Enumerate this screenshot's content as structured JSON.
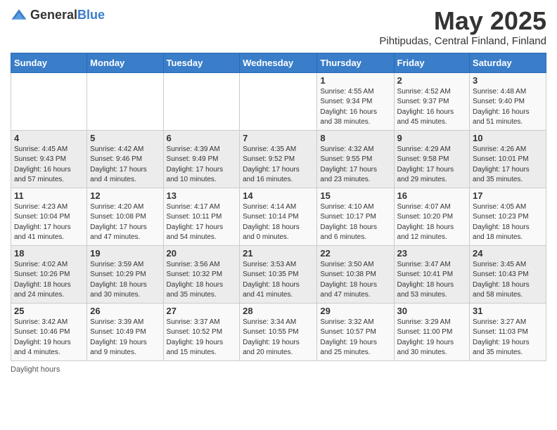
{
  "header": {
    "logo_general": "General",
    "logo_blue": "Blue",
    "month_title": "May 2025",
    "location": "Pihtipudas, Central Finland, Finland"
  },
  "days_of_week": [
    "Sunday",
    "Monday",
    "Tuesday",
    "Wednesday",
    "Thursday",
    "Friday",
    "Saturday"
  ],
  "weeks": [
    [
      {
        "day": "",
        "info": ""
      },
      {
        "day": "",
        "info": ""
      },
      {
        "day": "",
        "info": ""
      },
      {
        "day": "",
        "info": ""
      },
      {
        "day": "1",
        "info": "Sunrise: 4:55 AM\nSunset: 9:34 PM\nDaylight: 16 hours\nand 38 minutes."
      },
      {
        "day": "2",
        "info": "Sunrise: 4:52 AM\nSunset: 9:37 PM\nDaylight: 16 hours\nand 45 minutes."
      },
      {
        "day": "3",
        "info": "Sunrise: 4:48 AM\nSunset: 9:40 PM\nDaylight: 16 hours\nand 51 minutes."
      }
    ],
    [
      {
        "day": "4",
        "info": "Sunrise: 4:45 AM\nSunset: 9:43 PM\nDaylight: 16 hours\nand 57 minutes."
      },
      {
        "day": "5",
        "info": "Sunrise: 4:42 AM\nSunset: 9:46 PM\nDaylight: 17 hours\nand 4 minutes."
      },
      {
        "day": "6",
        "info": "Sunrise: 4:39 AM\nSunset: 9:49 PM\nDaylight: 17 hours\nand 10 minutes."
      },
      {
        "day": "7",
        "info": "Sunrise: 4:35 AM\nSunset: 9:52 PM\nDaylight: 17 hours\nand 16 minutes."
      },
      {
        "day": "8",
        "info": "Sunrise: 4:32 AM\nSunset: 9:55 PM\nDaylight: 17 hours\nand 23 minutes."
      },
      {
        "day": "9",
        "info": "Sunrise: 4:29 AM\nSunset: 9:58 PM\nDaylight: 17 hours\nand 29 minutes."
      },
      {
        "day": "10",
        "info": "Sunrise: 4:26 AM\nSunset: 10:01 PM\nDaylight: 17 hours\nand 35 minutes."
      }
    ],
    [
      {
        "day": "11",
        "info": "Sunrise: 4:23 AM\nSunset: 10:04 PM\nDaylight: 17 hours\nand 41 minutes."
      },
      {
        "day": "12",
        "info": "Sunrise: 4:20 AM\nSunset: 10:08 PM\nDaylight: 17 hours\nand 47 minutes."
      },
      {
        "day": "13",
        "info": "Sunrise: 4:17 AM\nSunset: 10:11 PM\nDaylight: 17 hours\nand 54 minutes."
      },
      {
        "day": "14",
        "info": "Sunrise: 4:14 AM\nSunset: 10:14 PM\nDaylight: 18 hours\nand 0 minutes."
      },
      {
        "day": "15",
        "info": "Sunrise: 4:10 AM\nSunset: 10:17 PM\nDaylight: 18 hours\nand 6 minutes."
      },
      {
        "day": "16",
        "info": "Sunrise: 4:07 AM\nSunset: 10:20 PM\nDaylight: 18 hours\nand 12 minutes."
      },
      {
        "day": "17",
        "info": "Sunrise: 4:05 AM\nSunset: 10:23 PM\nDaylight: 18 hours\nand 18 minutes."
      }
    ],
    [
      {
        "day": "18",
        "info": "Sunrise: 4:02 AM\nSunset: 10:26 PM\nDaylight: 18 hours\nand 24 minutes."
      },
      {
        "day": "19",
        "info": "Sunrise: 3:59 AM\nSunset: 10:29 PM\nDaylight: 18 hours\nand 30 minutes."
      },
      {
        "day": "20",
        "info": "Sunrise: 3:56 AM\nSunset: 10:32 PM\nDaylight: 18 hours\nand 35 minutes."
      },
      {
        "day": "21",
        "info": "Sunrise: 3:53 AM\nSunset: 10:35 PM\nDaylight: 18 hours\nand 41 minutes."
      },
      {
        "day": "22",
        "info": "Sunrise: 3:50 AM\nSunset: 10:38 PM\nDaylight: 18 hours\nand 47 minutes."
      },
      {
        "day": "23",
        "info": "Sunrise: 3:47 AM\nSunset: 10:41 PM\nDaylight: 18 hours\nand 53 minutes."
      },
      {
        "day": "24",
        "info": "Sunrise: 3:45 AM\nSunset: 10:43 PM\nDaylight: 18 hours\nand 58 minutes."
      }
    ],
    [
      {
        "day": "25",
        "info": "Sunrise: 3:42 AM\nSunset: 10:46 PM\nDaylight: 19 hours\nand 4 minutes."
      },
      {
        "day": "26",
        "info": "Sunrise: 3:39 AM\nSunset: 10:49 PM\nDaylight: 19 hours\nand 9 minutes."
      },
      {
        "day": "27",
        "info": "Sunrise: 3:37 AM\nSunset: 10:52 PM\nDaylight: 19 hours\nand 15 minutes."
      },
      {
        "day": "28",
        "info": "Sunrise: 3:34 AM\nSunset: 10:55 PM\nDaylight: 19 hours\nand 20 minutes."
      },
      {
        "day": "29",
        "info": "Sunrise: 3:32 AM\nSunset: 10:57 PM\nDaylight: 19 hours\nand 25 minutes."
      },
      {
        "day": "30",
        "info": "Sunrise: 3:29 AM\nSunset: 11:00 PM\nDaylight: 19 hours\nand 30 minutes."
      },
      {
        "day": "31",
        "info": "Sunrise: 3:27 AM\nSunset: 11:03 PM\nDaylight: 19 hours\nand 35 minutes."
      }
    ]
  ],
  "footer": {
    "daylight_label": "Daylight hours"
  }
}
